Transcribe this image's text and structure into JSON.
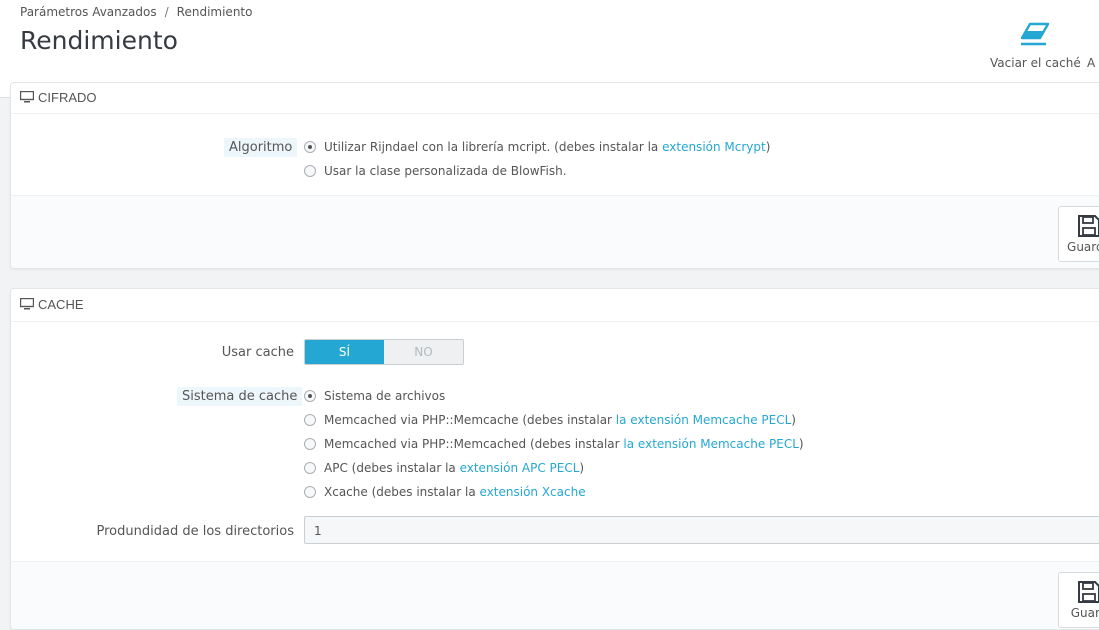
{
  "breadcrumb": {
    "parent": "Parámetros Avanzados",
    "separator": "/",
    "current": "Rendimiento"
  },
  "page_title": "Rendimiento",
  "toolbar": {
    "clear_cache_label": "Vaciar el caché",
    "next_label": "A"
  },
  "cipher_panel": {
    "title": "CIFRADO",
    "algorithm_label": "Algoritmo",
    "options": [
      {
        "text": "Utilizar Rijndael con la librería mcript. (debes instalar la ",
        "link": "extensión Mcrypt",
        "suffix": ")",
        "selected": true
      },
      {
        "text": "Usar la clase personalizada de BlowFish.",
        "link": "",
        "suffix": "",
        "selected": false
      }
    ],
    "save_label": "Guarda"
  },
  "cache_panel": {
    "title": "CACHE",
    "use_cache_label": "Usar cache",
    "switch": {
      "yes": "SÍ",
      "no": "NO",
      "value": "yes"
    },
    "system_label": "Sistema de cache",
    "options": [
      {
        "text": "Sistema de archivos",
        "link": "",
        "suffix": "",
        "selected": true
      },
      {
        "text": "Memcached via PHP::Memcache (debes instalar ",
        "link": "la extensión Memcache PECL",
        "suffix": ")",
        "selected": false
      },
      {
        "text": "Memcached via PHP::Memcached (debes instalar ",
        "link": "la extensión Memcache PECL",
        "suffix": ")",
        "selected": false
      },
      {
        "text": "APC (debes instalar la ",
        "link": "extensión APC PECL",
        "suffix": ")",
        "selected": false
      },
      {
        "text": "Xcache (debes instalar la ",
        "link": "extensión Xcache",
        "suffix": "",
        "selected": false
      }
    ],
    "depth_label": "Produndidad de los directorios",
    "depth_value": "1",
    "save_label": "Guard"
  },
  "colors": {
    "accent": "#25a7d3",
    "background": "#f1f3f5"
  },
  "icons": {
    "clear_cache": "eraser-icon",
    "panel": "monitor-icon",
    "save": "floppy-icon"
  }
}
